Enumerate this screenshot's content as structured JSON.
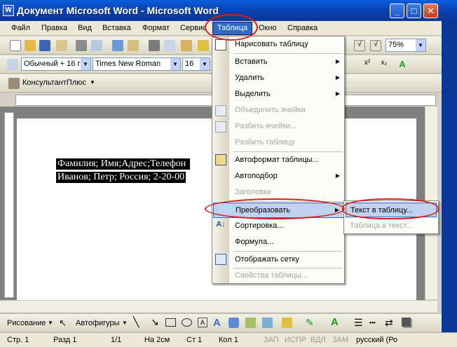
{
  "window": {
    "title": "Документ Microsoft Word - Microsoft Word",
    "minimize": "_",
    "maximize": "□",
    "close": "✕"
  },
  "menubar": [
    "Файл",
    "Правка",
    "Вид",
    "Вставка",
    "Формат",
    "Сервис",
    "Таблица",
    "Окно",
    "Справка"
  ],
  "toolbar": {
    "zoom": "75%"
  },
  "formatting": {
    "style": "Обычный + 16 г",
    "font": "Times New Roman",
    "size": "16"
  },
  "consultant": {
    "label": "КонсультантПлюс"
  },
  "document": {
    "line1": "Фамилия; Имя;Адрес;Телефон ",
    "line2": "Иванов; Петр; Россия; 2-20-00"
  },
  "table_menu": {
    "items": [
      {
        "label": "Нарисовать таблицу"
      },
      {
        "label": "Вставить",
        "submenu": true
      },
      {
        "label": "Удалить",
        "submenu": true
      },
      {
        "label": "Выделить",
        "submenu": true
      },
      {
        "label": "Объединить ячейки",
        "disabled": true
      },
      {
        "label": "Разбить ячейки...",
        "disabled": true
      },
      {
        "label": "Разбить таблицу",
        "disabled": true
      },
      {
        "label": "Автоформат таблицы..."
      },
      {
        "label": "Автоподбор",
        "submenu": true
      },
      {
        "label": "Заголовки",
        "disabled": true
      },
      {
        "label": "Преобразовать",
        "submenu": true,
        "highlighted": true
      },
      {
        "label": "Сортировка..."
      },
      {
        "label": "Формула..."
      },
      {
        "label": "Отображать сетку"
      },
      {
        "label": "Свойства таблицы...",
        "disabled": true
      }
    ]
  },
  "convert_submenu": {
    "items": [
      {
        "label": "Текст в таблицу...",
        "highlighted": true
      },
      {
        "label": "Таблица в текст...",
        "disabled": true
      }
    ]
  },
  "drawing_toolbar": {
    "draw": "Рисование",
    "autoshapes": "Автофигуры"
  },
  "statusbar": {
    "page": "Стр. 1",
    "section": "Разд 1",
    "pages": "1/1",
    "at": "На 2см",
    "line": "Ст 1",
    "col": "Кол 1",
    "rec": "ЗАП",
    "trk": "ИСПР",
    "ext": "ВДЛ",
    "ovr": "ЗАМ",
    "lang": "русский (Ро"
  },
  "colors": {
    "titlebar": "#0b3fae",
    "menu_highlight": "#c1d2ee",
    "highlight_border": "#316ac5",
    "annotation_ring": "#d81e1e"
  }
}
